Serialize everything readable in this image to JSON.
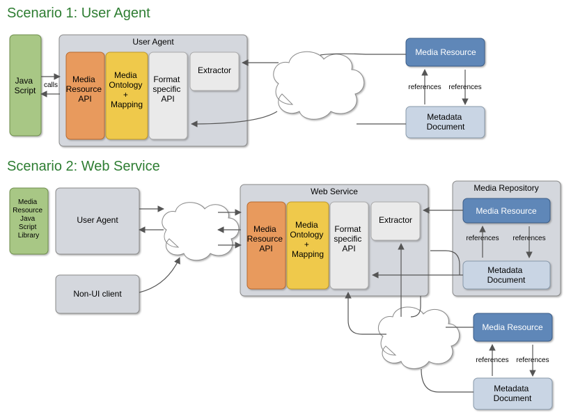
{
  "scenario1": {
    "title": "Scenario 1: User Agent",
    "javaScript": "Java Script",
    "calls": "calls",
    "userAgentTitle": "User Agent",
    "mediaResourceAPI": "Media Resource API",
    "mediaOntologyMapping": "Media Ontology + Mapping",
    "formatSpecificAPI": "Format specific API",
    "extractor": "Extractor",
    "mediaResource": "Media Resource",
    "references": "references",
    "metadataDocument": "Metadata Document"
  },
  "scenario2": {
    "title": "Scenario 2: Web Service",
    "mediaResourceJSLibrary": "Media Resource Java Script Library",
    "userAgent": "User Agent",
    "nonuiClient": "Non-UI client",
    "webServiceTitle": "Web Service",
    "mediaResourceAPI": "Media Resource API",
    "mediaOntologyMapping": "Media Ontology + Mapping",
    "formatSpecificAPI": "Format specific API",
    "extractor": "Extractor",
    "mediaRepositoryTitle": "Media Repository",
    "mediaResource": "Media Resource",
    "references": "references",
    "metadataDocument": "Metadata Document"
  },
  "colors": {
    "green": "#A8C785",
    "orange": "#E89A5D",
    "yellow": "#EFC94C",
    "blue": "#5E87B8",
    "lightblue": "#C9D5E4",
    "gray": "#EAEAEA",
    "lightgray": "#D9D9D9",
    "panelGray": "#D4D7DD",
    "stroke": "#888"
  }
}
